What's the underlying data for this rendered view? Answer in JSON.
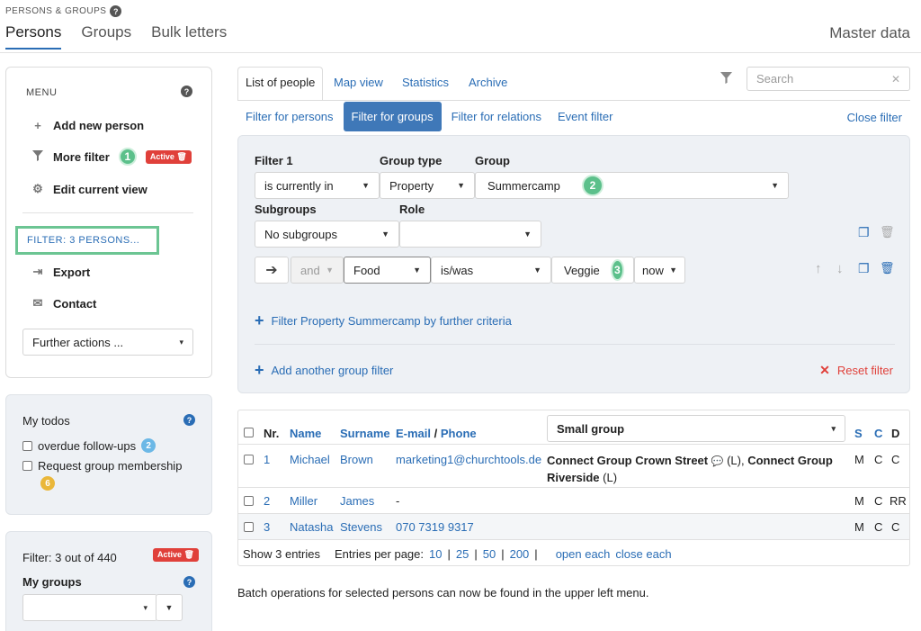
{
  "header": {
    "eyebrow": "PERSONS & GROUPS",
    "tabs": [
      "Persons",
      "Groups",
      "Bulk letters"
    ],
    "master_data": "Master data"
  },
  "sidebar": {
    "menu_title": "MENU",
    "items": [
      {
        "label": "Add new person",
        "icon": "plus-icon"
      },
      {
        "label": "More filter",
        "icon": "funnel-icon",
        "step": "1",
        "badge": "Active"
      },
      {
        "label": "Edit current view",
        "icon": "gear-icon"
      }
    ],
    "filter_link": "FILTER: 3 PERSONS...",
    "items2": [
      {
        "label": "Export",
        "icon": "export-icon"
      },
      {
        "label": "Contact",
        "icon": "envelope-icon"
      }
    ],
    "further_actions": "Further actions ..."
  },
  "todos": {
    "title": "My todos",
    "items": [
      {
        "label": "overdue follow-ups",
        "count": "2"
      },
      {
        "label": "Request group membership",
        "count": "6"
      }
    ]
  },
  "groups_box": {
    "filter_text": "Filter: 3 out of 440",
    "badge": "Active",
    "title": "My groups"
  },
  "main": {
    "tabs": [
      "List of people",
      "Map view",
      "Statistics",
      "Archive"
    ],
    "search_placeholder": "Search",
    "subtabs": [
      "Filter for persons",
      "Filter for groups",
      "Filter for relations",
      "Event filter"
    ],
    "close_filter": "Close filter",
    "filter": {
      "filter1_label": "Filter 1",
      "group_type_label": "Group type",
      "group_label": "Group",
      "filter1_value": "is currently in",
      "group_type_value": "Property",
      "group_value": "Summercamp",
      "step2": "2",
      "subgroups_label": "Subgroups",
      "role_label": "Role",
      "subgroups_value": "No subgroups",
      "role_value": "",
      "criteria_and": "and",
      "criteria_field": "Food",
      "criteria_op": "is/was",
      "criteria_value": "Veggie",
      "step3": "3",
      "criteria_time": "now",
      "further_criteria": "Filter Property Summercamp by further criteria",
      "add_group_filter": "Add another group filter",
      "reset_filter": "Reset filter"
    },
    "table": {
      "headers": {
        "nr": "Nr.",
        "name": "Name",
        "surname": "Surname",
        "email": "E-mail",
        "slash": "/",
        "phone": "Phone",
        "group_select": "Small group",
        "s": "S",
        "c": "C",
        "d": "D"
      },
      "rows": [
        {
          "nr": "1",
          "name": "Michael",
          "surname": "Brown",
          "contact": "marketing1@churchtools.de",
          "group_a": "Connect Group Crown Street",
          "group_a_suffix": "(L),",
          "group_b": "Connect Group Riverside",
          "group_b_suffix": "(L)",
          "s": "M",
          "c": "C",
          "d": "C"
        },
        {
          "nr": "2",
          "name": "Miller",
          "surname": "James",
          "contact": "-",
          "s": "M",
          "c": "C",
          "d": "RR"
        },
        {
          "nr": "3",
          "name": "Natasha",
          "surname": "Stevens",
          "contact": "070 7319 9317",
          "s": "M",
          "c": "C",
          "d": "C"
        }
      ],
      "footer": {
        "show": "Show 3 entries",
        "per_page_label": "Entries per page:",
        "sizes": [
          "10",
          "25",
          "50",
          "200"
        ],
        "open_each": "open each",
        "close_each": "close each"
      }
    },
    "batch_note": "Batch operations for selected persons can now be found in the upper left menu."
  },
  "colors": {
    "accent": "#2a6db5",
    "green": "#5cc08b",
    "red": "#e0403a",
    "panel": "#eef1f5"
  }
}
